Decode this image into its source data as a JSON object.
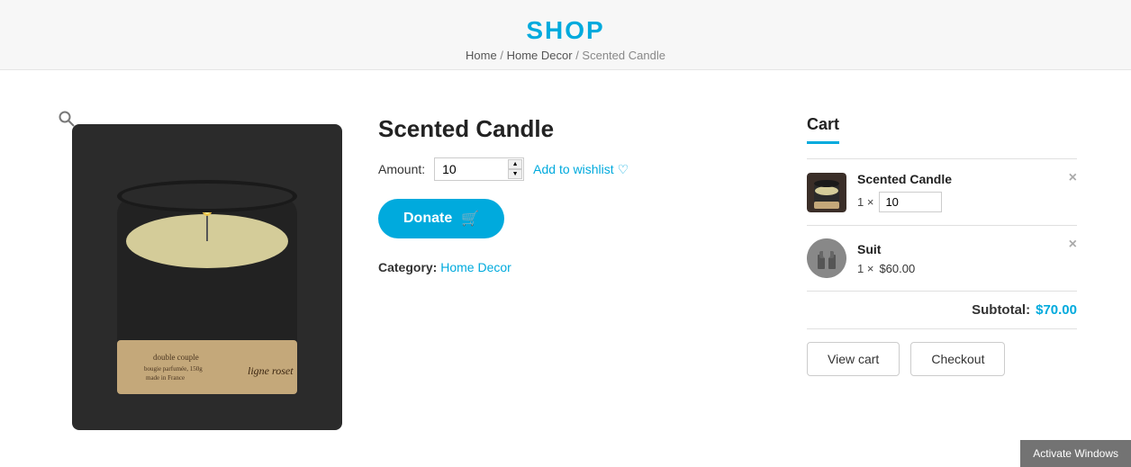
{
  "header": {
    "title": "SHOP",
    "breadcrumb": {
      "home": "Home",
      "separator1": "/",
      "section": "Home Decor",
      "separator2": "/",
      "current": "Scented Candle"
    }
  },
  "product": {
    "name": "Scented Candle",
    "amount_label": "Amount:",
    "amount_value": "10",
    "wishlist_label": "Add to wishlist",
    "donate_label": "Donate",
    "category_label": "Category:",
    "category_value": "Home Decor"
  },
  "cart": {
    "title": "Cart",
    "items": [
      {
        "name": "Scented Candle",
        "qty_prefix": "1 ×",
        "price_input": "10",
        "type": "candle"
      },
      {
        "name": "Suit",
        "qty_prefix": "1 ×",
        "price_text": "$60.00",
        "type": "suit"
      }
    ],
    "subtotal_label": "Subtotal:",
    "subtotal_amount": "$70.00",
    "view_cart_label": "View cart",
    "checkout_label": "Checkout"
  },
  "watermark": {
    "text": "Activate Windows"
  }
}
